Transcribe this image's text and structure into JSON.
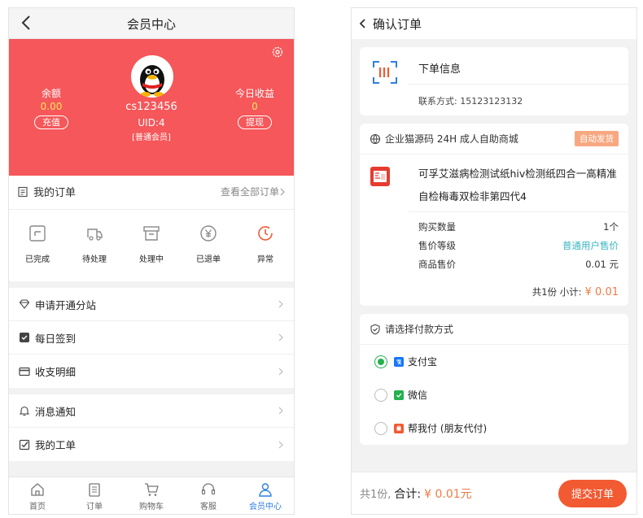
{
  "left": {
    "header_title": "会员中心",
    "user": {
      "name": "cs123456",
      "uid": "UID:4",
      "level": "[普通会员]"
    },
    "balance": {
      "label": "余额",
      "value": "0.00",
      "button": "充值"
    },
    "today_income": {
      "label": "今日收益",
      "value": "0",
      "button": "提现"
    },
    "orders": {
      "title": "我的订单",
      "view_all": "查看全部订单",
      "items": [
        {
          "label": "已完成",
          "icon": "check-doc-icon"
        },
        {
          "label": "待处理",
          "icon": "truck-icon"
        },
        {
          "label": "处理中",
          "icon": "box-icon"
        },
        {
          "label": "已退单",
          "icon": "yen-icon"
        },
        {
          "label": "异常",
          "icon": "clock-icon"
        }
      ]
    },
    "menu_group1": [
      {
        "label": "申请开通分站",
        "icon": "diamond-icon"
      },
      {
        "label": "每日签到",
        "icon": "checkbox-icon"
      },
      {
        "label": "收支明细",
        "icon": "card-icon"
      }
    ],
    "menu_group2": [
      {
        "label": "消息通知",
        "icon": "bell-icon"
      },
      {
        "label": "我的工单",
        "icon": "check-square-icon"
      }
    ],
    "tabbar": [
      {
        "label": "首页",
        "icon": "home-icon"
      },
      {
        "label": "订单",
        "icon": "clipboard-icon"
      },
      {
        "label": "购物车",
        "icon": "cart-icon"
      },
      {
        "label": "客服",
        "icon": "headset-icon"
      },
      {
        "label": "会员中心",
        "icon": "user-icon",
        "active": true
      }
    ],
    "colors": {
      "hero": "#f5575a",
      "active_tab": "#2f7fe0",
      "value_yellow": "#ffe35a"
    }
  },
  "right": {
    "header_title": "确认订单",
    "order_info": {
      "title": "下单信息",
      "contact": "联系方式: 15123123132"
    },
    "shop": {
      "name": "企业猫源码 24H 成人自助商城",
      "badge": "自动发货",
      "product_name": "可孚艾滋病检测试纸hiv检测纸四合一高精准自检梅毒双检非第四代4",
      "rows": [
        {
          "label": "购买数量",
          "value": "1个"
        },
        {
          "label": "售价等级",
          "value": "普通用户售价"
        },
        {
          "label": "商品售价",
          "value": "0.01 元"
        }
      ],
      "summary_text": "共1份 小计:",
      "summary_price": "¥ 0.01"
    },
    "payment": {
      "title": "请选择付款方式",
      "options": [
        {
          "label": "支付宝",
          "selected": true,
          "icon": "alipay-icon",
          "color": "#1677ff"
        },
        {
          "label": "微信",
          "selected": false,
          "icon": "wechat-icon",
          "color": "#23b14d"
        },
        {
          "label": "帮我付 (朋友代付)",
          "selected": false,
          "icon": "friend-pay-icon",
          "color": "#f25a32"
        }
      ]
    },
    "bottom": {
      "count": "共1份,",
      "total_label": "合计:",
      "total_amount": "¥ 0.01元",
      "submit": "提交订单"
    },
    "colors": {
      "accent": "#f25a32",
      "radio": "#23b14d",
      "badge": "#f8a880"
    }
  }
}
